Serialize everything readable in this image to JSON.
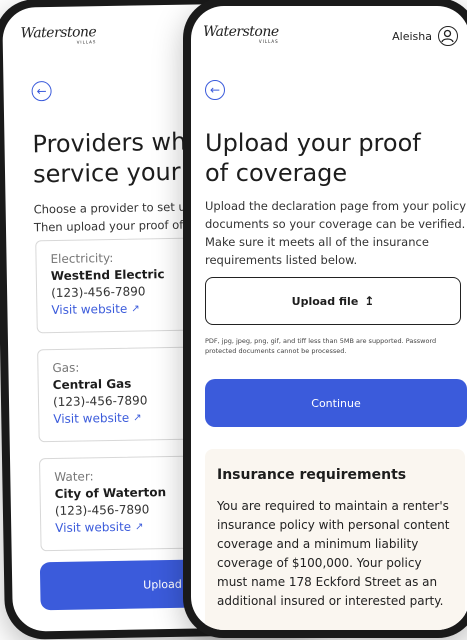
{
  "brand": {
    "name": "Waterstone",
    "sub": "VILLAS"
  },
  "user": {
    "name": "Aleisha"
  },
  "back_screen": {
    "title_line1": "Providers wh",
    "title_line2": "service your",
    "desc_line1": "Choose a provider to set u",
    "desc_line2": "Then upload your proof of",
    "providers": [
      {
        "type": "Electricity:",
        "name": "WestEnd Electric",
        "phone": "(123)-456-7890",
        "link": "Visit website"
      },
      {
        "type": "Gas:",
        "name": "Central Gas",
        "phone": "(123)-456-7890",
        "link": "Visit website"
      },
      {
        "type": "Water:",
        "name": "City of Waterton",
        "phone": "(123)-456-7890",
        "link": "Visit website"
      }
    ],
    "cta": "Upload proof of s"
  },
  "front_screen": {
    "title_line1": "Upload your proof",
    "title_line2": "of coverage",
    "desc": "Upload the declaration page from your policy documents so your coverage can be verified. Make sure it meets all of the insurance requirements listed below.",
    "upload_label": "Upload file",
    "fine_print": "PDF, jpg, jpeg, png, gif, and tiff less than 5MB are supported. Password protected documents cannot be processed.",
    "continue_label": "Continue",
    "requirements": {
      "title": "Insurance requirements",
      "body": "You are required to maintain a renter's insurance policy with personal content coverage and a minimum liability coverage of $100,000. Your policy must name 178 Eckford Street as an additional insured or interested party."
    }
  },
  "colors": {
    "accent": "#3b5bdb",
    "requirements_bg": "#faf6f0"
  }
}
